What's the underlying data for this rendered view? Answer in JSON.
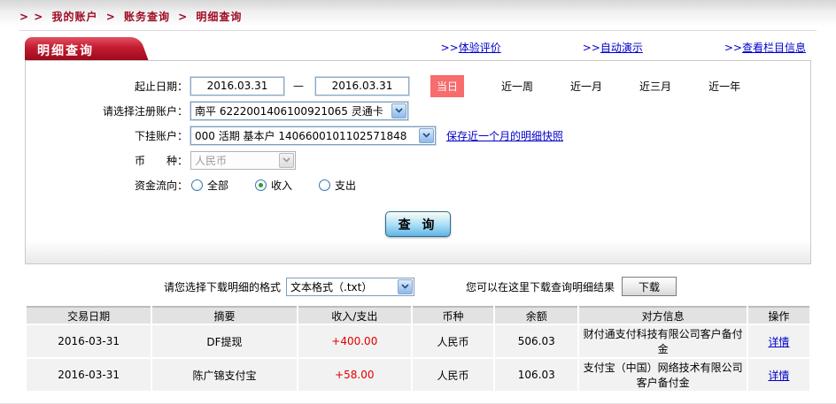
{
  "colors": {
    "brand_red": "#9e0b23",
    "tab_red": "#c51b31",
    "link_blue": "#0000cc",
    "quick_active_bg": "#f76c6c",
    "amount_red": "#e00000"
  },
  "breadcrumb": {
    "prefix": "> >",
    "sep": ">",
    "items": [
      "我的账户",
      "账务查询",
      "明细查询"
    ]
  },
  "tab": {
    "title": "明细查询"
  },
  "header_links": [
    {
      "prefix": ">>",
      "label": "体验评价"
    },
    {
      "prefix": ">>",
      "label": "自动演示"
    },
    {
      "prefix": ">>",
      "label": "查看栏目信息"
    }
  ],
  "form": {
    "date_range": {
      "label": "起止日期：",
      "start": "2016.03.31",
      "dash": "—",
      "end": "2016.03.31",
      "quick_active": "当日",
      "quick_options": [
        "近一周",
        "近一月",
        "近三月",
        "近一年"
      ]
    },
    "register_account": {
      "label": "请选择注册账户：",
      "value": "南平  6222001406100921065  灵通卡"
    },
    "sub_account": {
      "label": "下挂账户：",
      "value": "000 活期 基本户 1406600101102571848",
      "snapshot_link": "保存近一个月的明细快照"
    },
    "currency": {
      "label": "币　　种：",
      "value": "人民币"
    },
    "flow": {
      "label": "资金流向：",
      "options": [
        "全部",
        "收入",
        "支出"
      ],
      "selected": "收入"
    },
    "query_button": "查 询"
  },
  "download": {
    "format_label": "请您选择下载明细的格式",
    "format_value": "文本格式（.txt）",
    "hint": "您可以在这里下载查询明细结果",
    "button": "下载"
  },
  "table": {
    "headers": [
      "交易日期",
      "摘要",
      "收入/支出",
      "币种",
      "余额",
      "对方信息",
      "操作"
    ],
    "rows": [
      {
        "date": "2016-03-31",
        "summary": "DF提现",
        "amount": "+400.00",
        "currency": "人民币",
        "balance": "506.03",
        "counterparty": "财付通支付科技有限公司客户备付金",
        "action": "详情"
      },
      {
        "date": "2016-03-31",
        "summary": "陈广锦支付宝",
        "amount": "+58.00",
        "currency": "人民币",
        "balance": "106.03",
        "counterparty": "支付宝（中国）网络技术有限公司客户备付金",
        "action": "详情"
      }
    ]
  }
}
